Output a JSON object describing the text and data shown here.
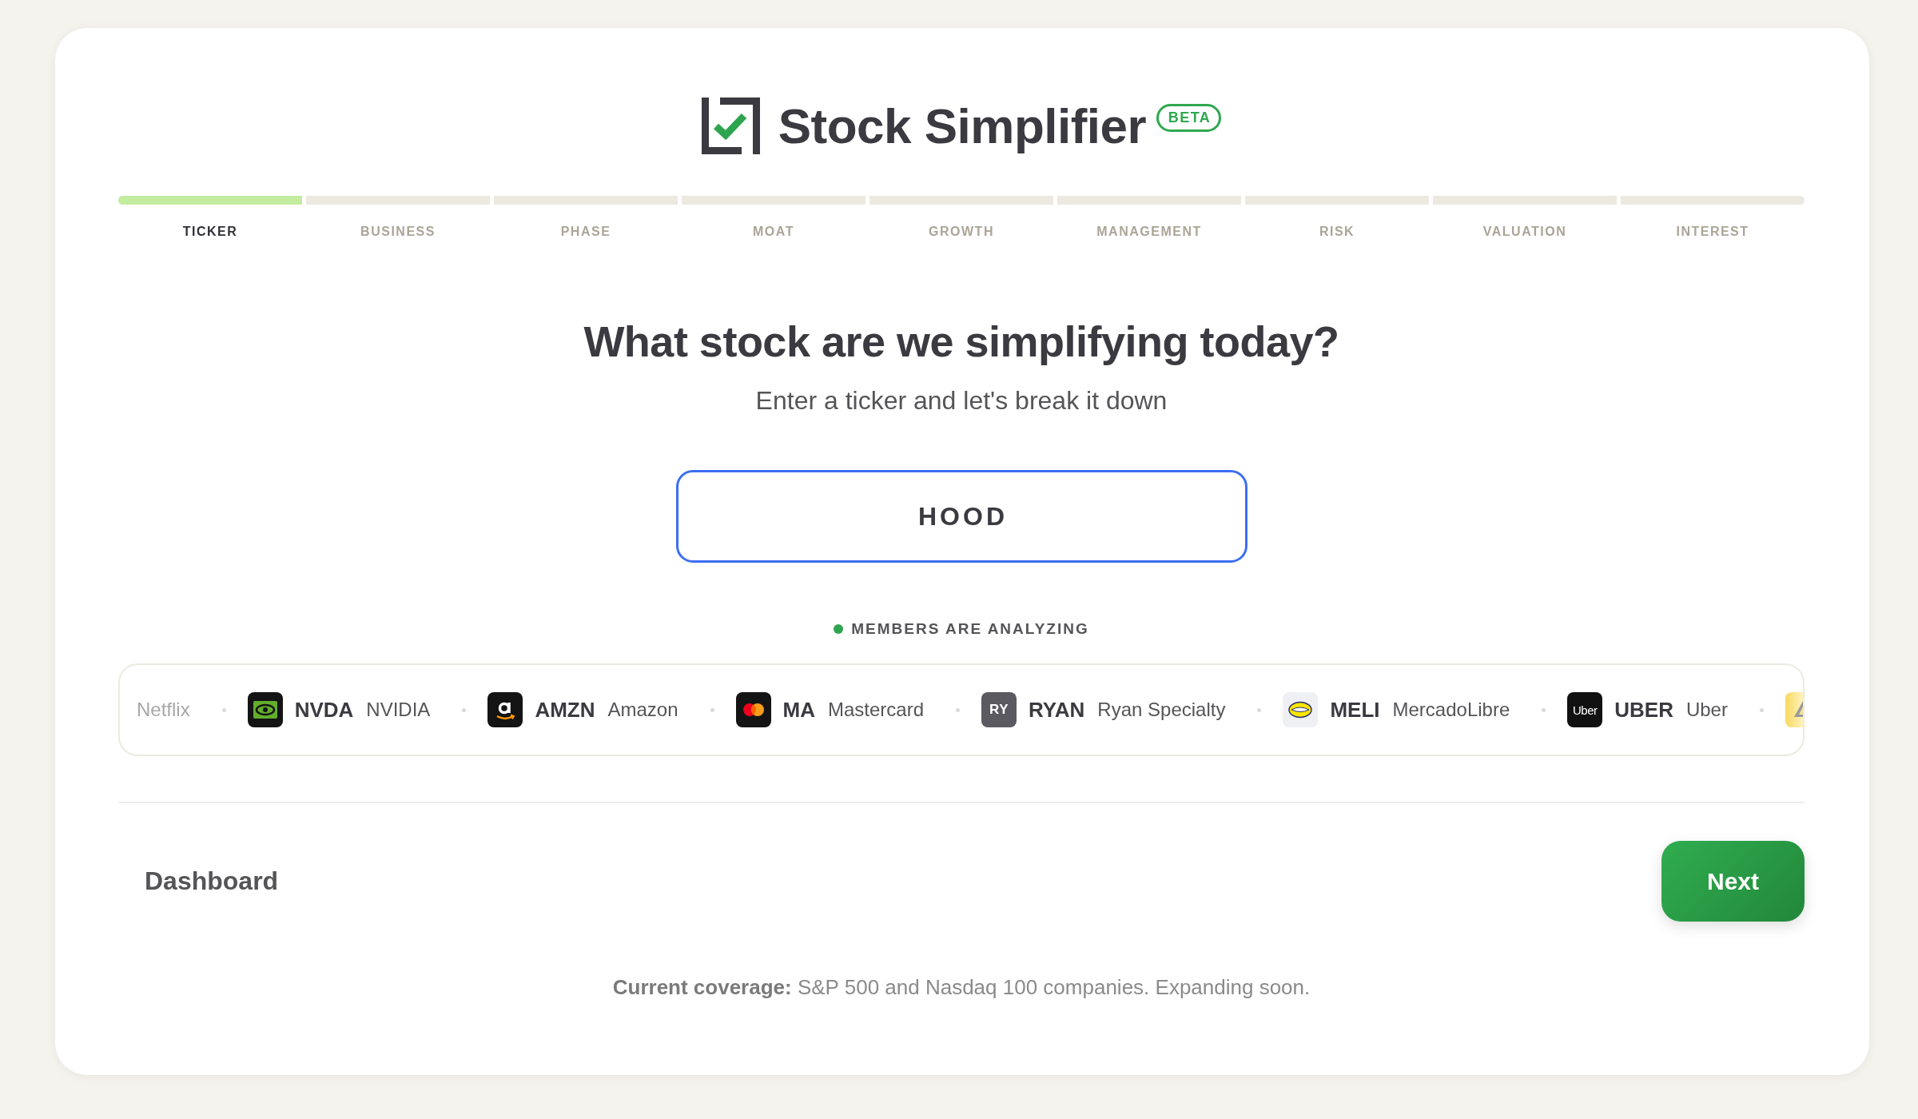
{
  "header": {
    "title": "Stock Simplifier",
    "badge": "BETA"
  },
  "steps": [
    {
      "label": "TICKER",
      "selected": true
    },
    {
      "label": "BUSINESS",
      "selected": false
    },
    {
      "label": "PHASE",
      "selected": false
    },
    {
      "label": "MOAT",
      "selected": false
    },
    {
      "label": "GROWTH",
      "selected": false
    },
    {
      "label": "MANAGEMENT",
      "selected": false
    },
    {
      "label": "RISK",
      "selected": false
    },
    {
      "label": "VALUATION",
      "selected": false
    },
    {
      "label": "INTEREST",
      "selected": false
    }
  ],
  "heading": "What stock are we simplifying today?",
  "subheading": "Enter a ticker and let's break it down",
  "ticker_field": {
    "value": "HOOD",
    "focused": true
  },
  "activity": {
    "label": "MEMBERS ARE ANALYZING",
    "live": true
  },
  "tickers": [
    {
      "kind": "name_only",
      "name": "Netflix"
    },
    {
      "kind": "full",
      "logo": {
        "kind": "eye"
      },
      "ticker": "NVDA",
      "name": "NVIDIA"
    },
    {
      "kind": "full",
      "logo": {
        "kind": "smile"
      },
      "ticker": "AMZN",
      "name": "Amazon"
    },
    {
      "kind": "full",
      "logo": {
        "kind": "circles"
      },
      "ticker": "MA",
      "name": "Mastercard"
    },
    {
      "kind": "full",
      "logo": {
        "kind": "initials",
        "text": "RY"
      },
      "ticker": "RYAN",
      "name": "Ryan Specialty"
    },
    {
      "kind": "full",
      "logo": {
        "kind": "oval"
      },
      "ticker": "MELI",
      "name": "MercadoLibre"
    },
    {
      "kind": "full",
      "logo": {
        "kind": "wordmark",
        "text": "Uber"
      },
      "ticker": "UBER",
      "name": "Uber"
    },
    {
      "kind": "logo_only",
      "logo": {
        "kind": "triangle"
      }
    }
  ],
  "footer_nav": {
    "back": "Dashboard",
    "next": "Next"
  },
  "coverage_note": "**Current coverage:** S&P 500 and Nasdaq 100 companies. Expanding soon."
}
